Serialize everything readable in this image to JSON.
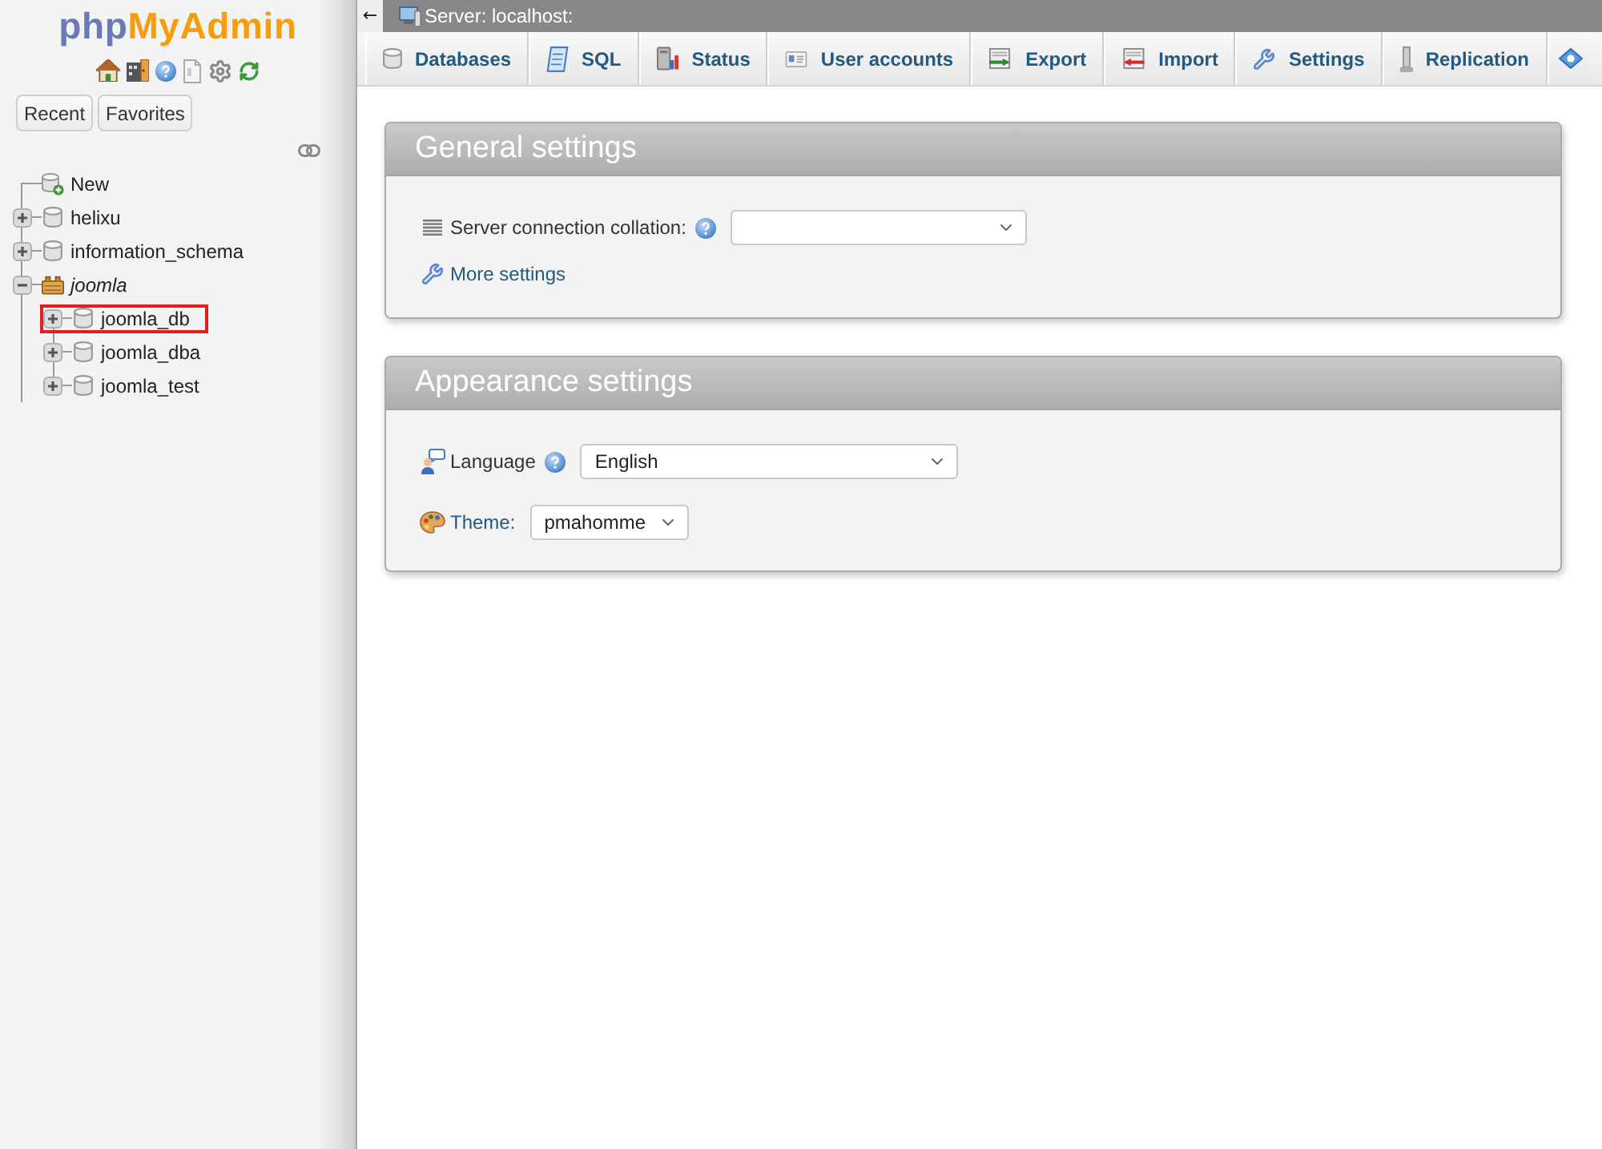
{
  "sidebar": {
    "logo": {
      "prefix": "php",
      "name": "MyAdmin"
    },
    "buttons": [
      {
        "label": "Recent"
      },
      {
        "label": "Favorites"
      }
    ],
    "tree": [
      {
        "kind": "new",
        "label": "New",
        "highlighted": false
      },
      {
        "kind": "database",
        "label": "helixu",
        "expanded": false,
        "highlighted": false
      },
      {
        "kind": "database",
        "label": "information_schema",
        "expanded": false,
        "highlighted": false
      },
      {
        "kind": "group",
        "label": "joomla",
        "expanded": true,
        "highlighted": false,
        "children": [
          {
            "kind": "database",
            "label": "joomla_db",
            "expanded": false,
            "highlighted": true
          },
          {
            "kind": "database",
            "label": "joomla_dba",
            "expanded": false,
            "highlighted": false
          },
          {
            "kind": "database",
            "label": "joomla_test",
            "expanded": false,
            "highlighted": false
          }
        ]
      }
    ]
  },
  "topbar": {
    "collapse_button": "←",
    "breadcrumb": "Server: localhost:"
  },
  "tabs": [
    {
      "label": "Databases",
      "selected": false
    },
    {
      "label": "SQL",
      "selected": false
    },
    {
      "label": "Status",
      "selected": false
    },
    {
      "label": "User accounts",
      "selected": false
    },
    {
      "label": "Export",
      "selected": false
    },
    {
      "label": "Import",
      "selected": false
    },
    {
      "label": "Settings",
      "selected": false
    },
    {
      "label": "Replication",
      "selected": false
    }
  ],
  "panels": [
    {
      "title": "General settings",
      "rows": [
        {
          "kind": "select",
          "label": "Server connection collation:",
          "help": true,
          "label_link": false
        },
        {
          "kind": "link",
          "label": "More settings"
        }
      ]
    },
    {
      "title": "Appearance settings",
      "rows": [
        {
          "kind": "select",
          "label": "Language",
          "help": true,
          "label_link": false,
          "value": "English"
        },
        {
          "kind": "select",
          "label": "Theme:",
          "help": false,
          "label_link": true,
          "value": "pmahomme"
        }
      ]
    }
  ]
}
